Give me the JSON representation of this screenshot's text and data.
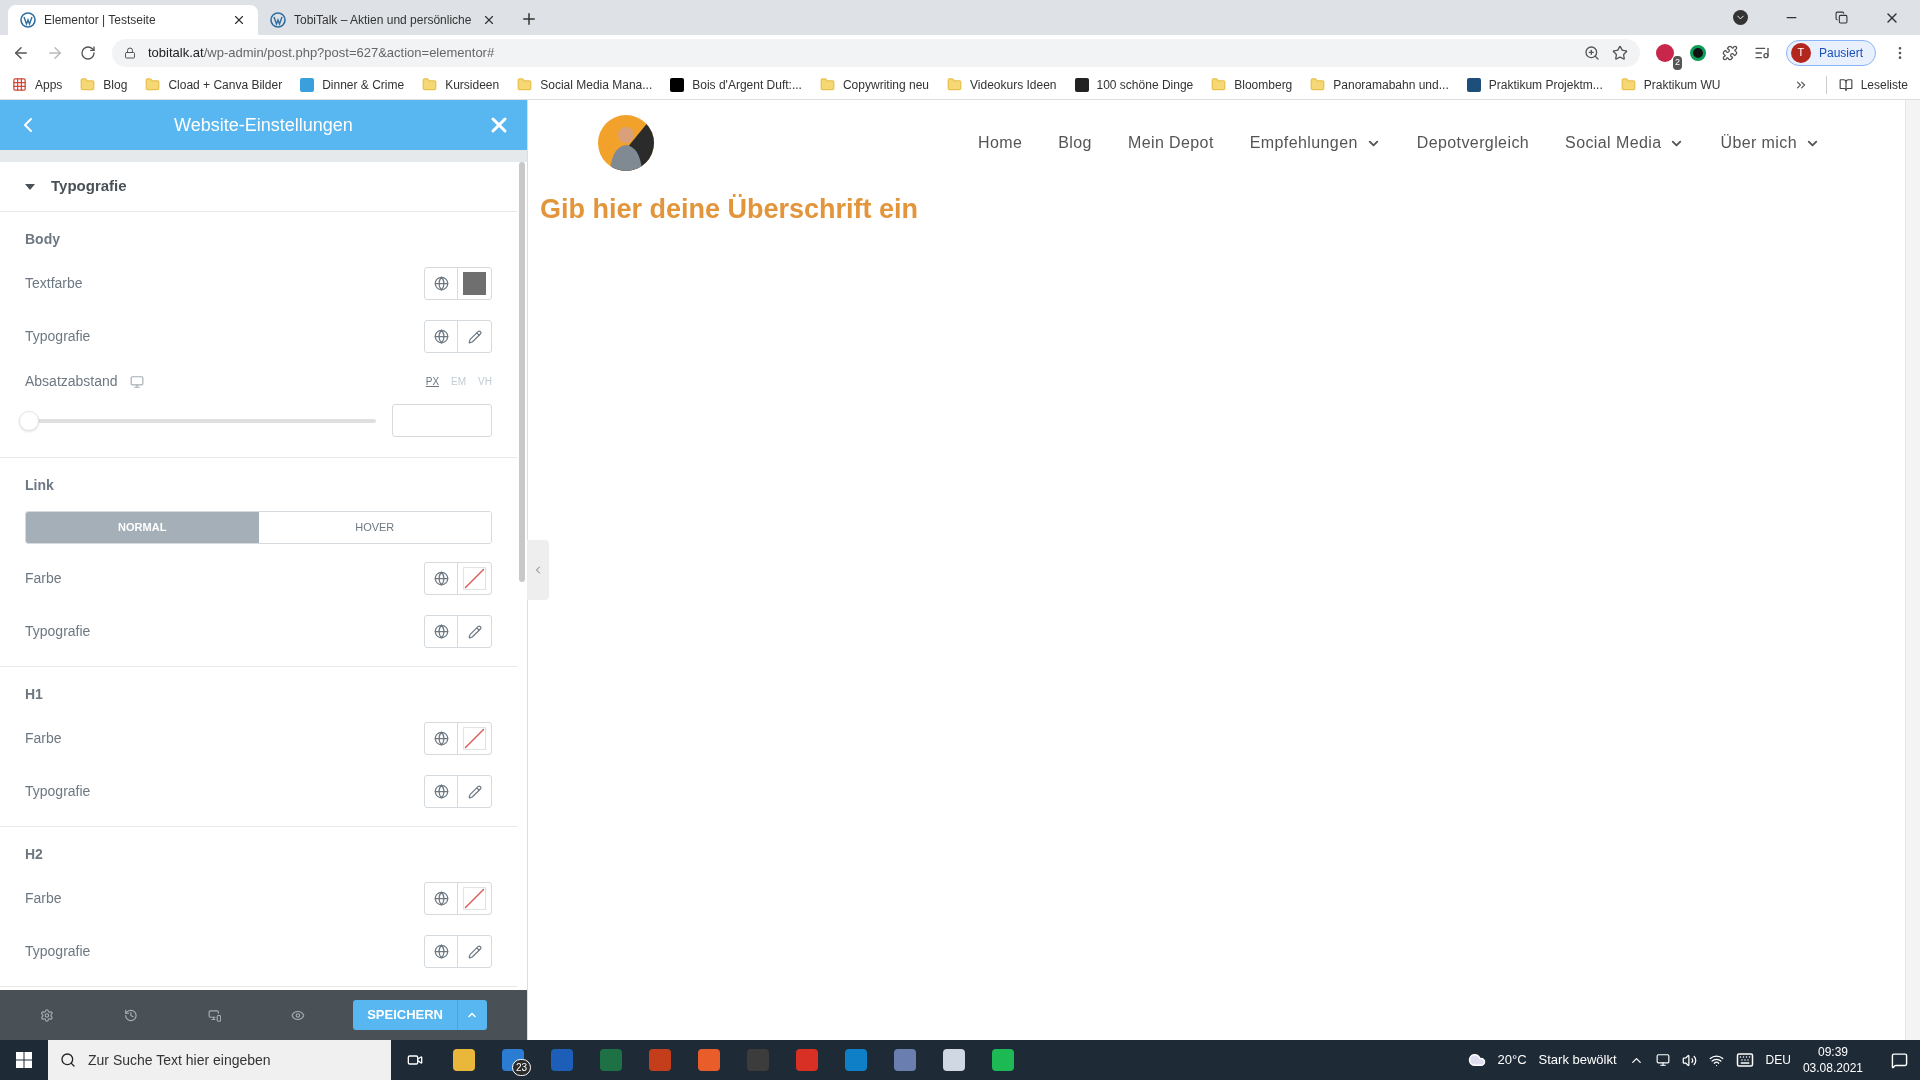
{
  "browser": {
    "tabs": [
      {
        "title": "Elementor | Testseite",
        "selected": true
      },
      {
        "title": "TobiTalk – Aktien und persönliche",
        "selected": false
      }
    ],
    "address": {
      "host": "tobitalk.at",
      "path": "/wp-admin/post.php?post=627&action=elementor#"
    },
    "bookmarks": [
      {
        "label": "Apps",
        "kind": "apps"
      },
      {
        "label": "Blog",
        "kind": "folder"
      },
      {
        "label": "Cload + Canva Bilder",
        "kind": "folder"
      },
      {
        "label": "Dinner & Crime",
        "kind": "site",
        "color": "#3aa0dd"
      },
      {
        "label": "Kursideen",
        "kind": "folder"
      },
      {
        "label": "Social Media Mana...",
        "kind": "folder"
      },
      {
        "label": "Bois d'Argent Duft:...",
        "kind": "site",
        "color": "#000000"
      },
      {
        "label": "Copywriting neu",
        "kind": "folder"
      },
      {
        "label": "Videokurs Ideen",
        "kind": "folder"
      },
      {
        "label": "100 schöne Dinge",
        "kind": "site",
        "color": "#222222"
      },
      {
        "label": "Bloomberg",
        "kind": "folder"
      },
      {
        "label": "Panoramabahn und...",
        "kind": "folder"
      },
      {
        "label": "Praktikum Projektm...",
        "kind": "site",
        "color": "#1e4f7a"
      },
      {
        "label": "Praktikum WU",
        "kind": "folder"
      }
    ],
    "extension_badge": "2",
    "profile": {
      "initial": "T",
      "label": "Pausiert"
    },
    "reading_list": "Leseliste"
  },
  "panel": {
    "title": "Website-Einstellungen",
    "section": {
      "title": "Typografie",
      "expanded": true
    },
    "groups": [
      {
        "heading": "Body",
        "rows": [
          {
            "kind": "color",
            "label": "Textfarbe",
            "color": "#6f6f6f"
          },
          {
            "kind": "typography",
            "label": "Typografie"
          },
          {
            "kind": "slider",
            "label": "Absatzabstand",
            "level": 0,
            "units": [
              {
                "label": "PX",
                "selected": true
              },
              {
                "label": "EM",
                "selected": false
              },
              {
                "label": "VH",
                "selected": false
              }
            ]
          }
        ]
      },
      {
        "heading": "Link",
        "states": [
          {
            "label": "NORMAL",
            "selected": true
          },
          {
            "label": "HOVER",
            "selected": false
          }
        ],
        "rows": [
          {
            "kind": "color",
            "label": "Farbe"
          },
          {
            "kind": "typography",
            "label": "Typografie"
          }
        ]
      },
      {
        "heading": "H1",
        "rows": [
          {
            "kind": "color",
            "label": "Farbe"
          },
          {
            "kind": "typography",
            "label": "Typografie"
          }
        ]
      },
      {
        "heading": "H2",
        "rows": [
          {
            "kind": "color",
            "label": "Farbe"
          },
          {
            "kind": "typography",
            "label": "Typografie"
          }
        ]
      }
    ],
    "save": "SPEICHERN"
  },
  "site": {
    "nav": [
      {
        "label": "Home",
        "dropdown": false
      },
      {
        "label": "Blog",
        "dropdown": false
      },
      {
        "label": "Mein Depot",
        "dropdown": false
      },
      {
        "label": "Empfehlungen",
        "dropdown": true
      },
      {
        "label": "Depotvergleich",
        "dropdown": false
      },
      {
        "label": "Social Media",
        "dropdown": true
      },
      {
        "label": "Über mich",
        "dropdown": true
      }
    ],
    "heading": "Gib hier deine Überschrift ein"
  },
  "taskbar": {
    "search_placeholder": "Zur Suche Text hier eingeben",
    "mail_badge": "23",
    "temperature": "20°C",
    "weather": "Stark bewölkt",
    "language": "DEU",
    "time": "09:39",
    "date": "03.08.2021"
  }
}
